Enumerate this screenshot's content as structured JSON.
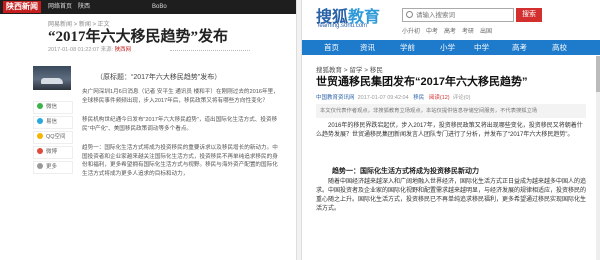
{
  "left": {
    "logo": "陕西新闻",
    "nav": [
      "网络首页",
      "陕西",
      "",
      "",
      "",
      "BoBo",
      "",
      "",
      ""
    ],
    "breadcrumb": "网易新闻 > 新闻 > 正文",
    "title": "“2017年六大移民趋势”发布",
    "meta_date": "2017-01-08 01:22:07  来源:",
    "meta_source": "陕西网",
    "sub_title": "（原标题：“2017年六大移民趋势”发布）",
    "share": [
      {
        "label": "微信",
        "color": "#3bb34a"
      },
      {
        "label": "易信",
        "color": "#27a9e0"
      },
      {
        "label": "QQ空间",
        "color": "#f5b400"
      },
      {
        "label": "微博",
        "color": "#e04a3a"
      },
      {
        "label": "更多",
        "color": "#999999"
      }
    ],
    "paragraphs": [
      "央广网深圳1月6日消息（记者 安平生 通讯员 楼和平）在刚刚过去的2016年里，全球移民事件频频出现，步入2017年后，移民政策又将有哪些方向性变化？",
      "移民机构世纪通今日发布“2017年六大移民趋势”，道出国际化生活方式、投资移民“中产化”、美国移民政策调动等多个看点。",
      "趋势一：国际化生活方式将成为投资移民的重要诉求以及移民增长的新动力。中国投资者和企业家越来越关注国际化生活方式，投资移民不再单纯追求移民的身份和福利，更多希望拥有国际化生活方式与视野。移民与海外资产配置的国际化生活方式将成为更多人追求的目标和动力，"
    ]
  },
  "right": {
    "logo_main": "搜狐",
    "logo_edu": "教育",
    "url": "learning.sohu.com",
    "search_placeholder": "请输入搜索词",
    "search_button": "搜索",
    "subnav": [
      "小升初",
      "中考",
      "高考",
      "考研",
      "出国"
    ],
    "nav": [
      "首页",
      "资讯",
      "学前",
      "小学",
      "中学",
      "高考",
      "高校"
    ],
    "breadcrumb": "搜狐教育 > 留学 > 移民",
    "title": "世贸通移民集团发布“2017年六大移民趋势”",
    "meta_date": "2017-01-07 09:42:04",
    "meta_source": "中国教育资讯网",
    "meta_label": "移民",
    "meta_views": "阅读(12)",
    "meta_comments": "评论(0)",
    "summary": "本文仅代表作者观点，非搜狐教育立场观点，本站仅提供信息存储空间服务，不代表搜狐立场",
    "paragraphs": [
      "2016年的移民界跌宕起伏，步入2017年，投资移民政策又将出现哪些变化，投资移民又将朝着什么趋势发展？世贸通移民集团新闻发言人团队专门进行了分析，并发布了“2017年六大移民趋势”。",
      "随着中国经济越来越深入和广阔地融入世界经济，国际化生活方式正日益成为越来越多中国人的追求。中国投资者及企业家的国际化视野和配置需求越来越明显，与经济发展的规律相适应，投资移民的重心随之上升。国际化生活方式，投资移民已不再单纯追求移民福利，更多希望通过移民实现国际化生活方式。"
    ],
    "trend_title": "趋势一：国际化生活方式将成为投资移民新动力"
  }
}
